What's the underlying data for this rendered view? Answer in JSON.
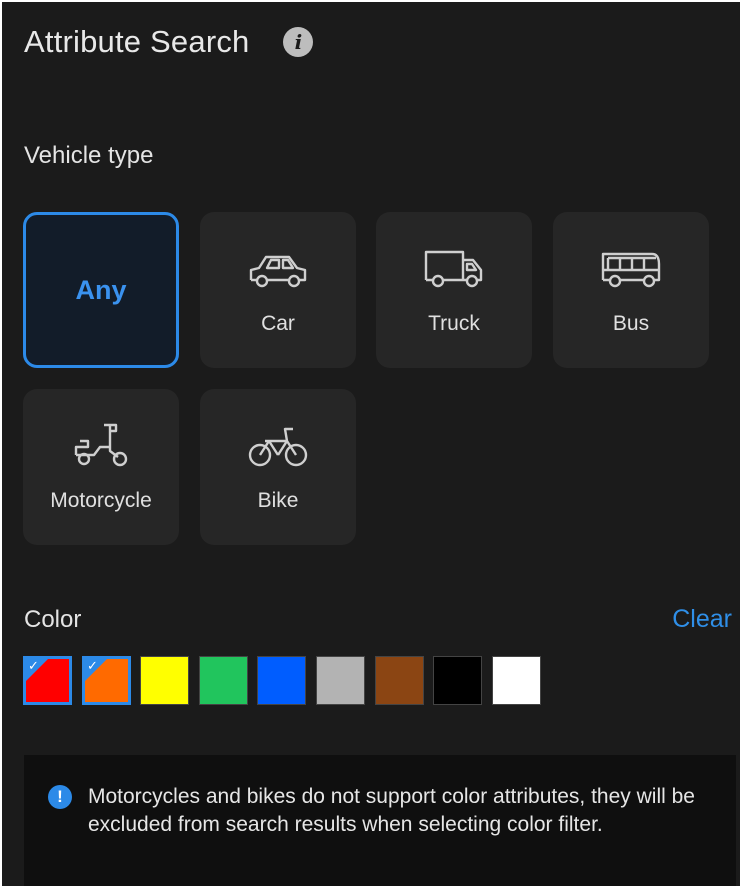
{
  "header": {
    "title": "Attribute Search",
    "info_icon": "info-icon"
  },
  "vehicle_type": {
    "label": "Vehicle type",
    "options": [
      {
        "label": "Any",
        "icon": "",
        "selected": true
      },
      {
        "label": "Car",
        "icon": "car-icon",
        "selected": false
      },
      {
        "label": "Truck",
        "icon": "truck-icon",
        "selected": false
      },
      {
        "label": "Bus",
        "icon": "bus-icon",
        "selected": false
      },
      {
        "label": "Motorcycle",
        "icon": "motorcycle-icon",
        "selected": false
      },
      {
        "label": "Bike",
        "icon": "bike-icon",
        "selected": false
      }
    ]
  },
  "color": {
    "label": "Color",
    "clear_label": "Clear",
    "swatches": [
      {
        "name": "red",
        "hex": "#ff0000",
        "checked": true
      },
      {
        "name": "orange",
        "hex": "#ff6a00",
        "checked": true
      },
      {
        "name": "yellow",
        "hex": "#ffff00",
        "checked": false
      },
      {
        "name": "green",
        "hex": "#21c55d",
        "checked": false
      },
      {
        "name": "blue",
        "hex": "#005dff",
        "checked": false
      },
      {
        "name": "gray",
        "hex": "#b3b3b3",
        "checked": false
      },
      {
        "name": "brown",
        "hex": "#8b4513",
        "checked": false
      },
      {
        "name": "black",
        "hex": "#000000",
        "checked": false
      },
      {
        "name": "white",
        "hex": "#ffffff",
        "checked": false
      }
    ]
  },
  "notice": {
    "icon": "info-icon",
    "text": "Motorcycles and bikes do not support color attributes, they will be excluded from search results when selecting color filter."
  },
  "theme": {
    "accent": "#2c8ae8",
    "background": "#1b1b1b",
    "tile": "#262626"
  }
}
